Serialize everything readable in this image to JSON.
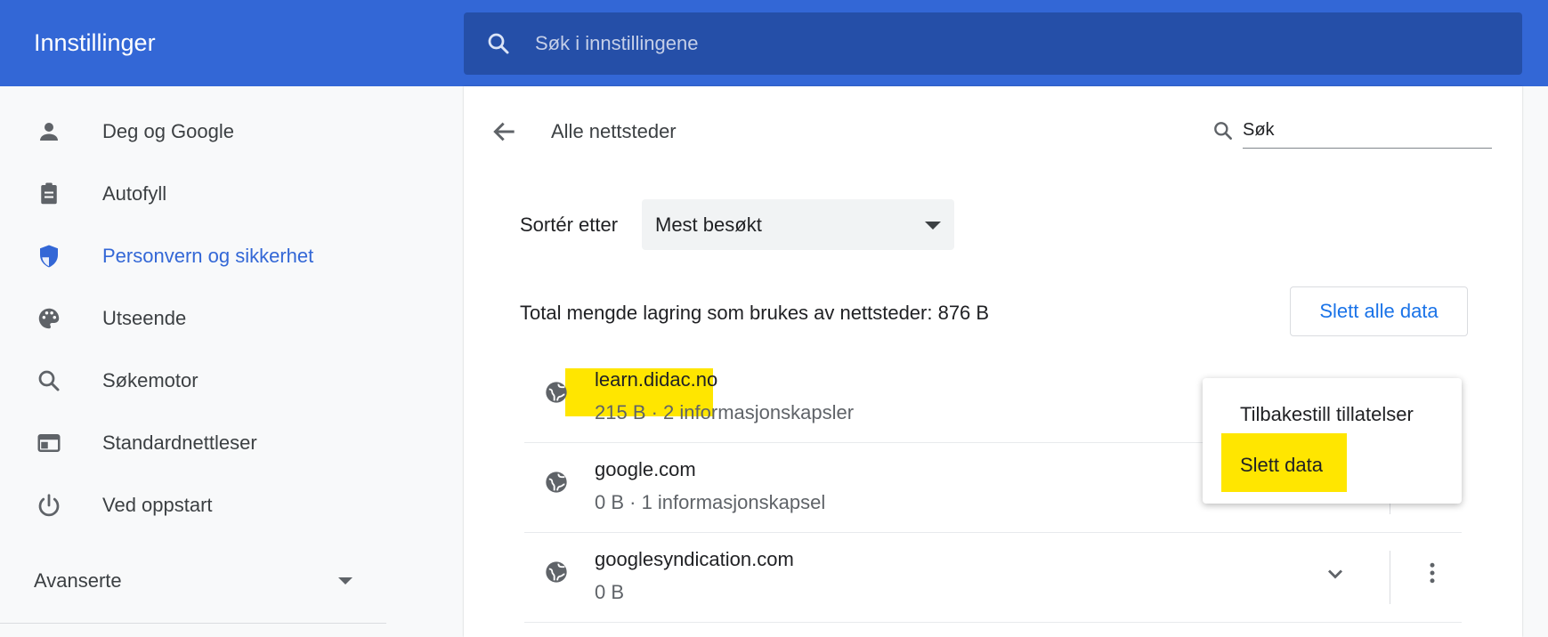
{
  "header": {
    "title": "Innstillinger",
    "search_placeholder": "Søk i innstillingene"
  },
  "sidebar": {
    "items": [
      {
        "label": "Deg og Google",
        "icon": "person-icon"
      },
      {
        "label": "Autofyll",
        "icon": "clipboard-icon"
      },
      {
        "label": "Personvern og sikkerhet",
        "icon": "shield-icon",
        "active": true
      },
      {
        "label": "Utseende",
        "icon": "palette-icon"
      },
      {
        "label": "Søkemotor",
        "icon": "search-icon"
      },
      {
        "label": "Standardnettleser",
        "icon": "browser-window-icon"
      },
      {
        "label": "Ved oppstart",
        "icon": "power-icon"
      }
    ],
    "advanced_label": "Avanserte"
  },
  "main": {
    "title": "Alle nettsteder",
    "filter_value": "Søk",
    "sort_label": "Sortér etter",
    "sort_value": "Mest besøkt",
    "total_label": "Total mengde lagring som brukes av nettsteder: 876 B",
    "clear_all_label": "Slett alle data",
    "sites": [
      {
        "name": "learn.didac.no",
        "meta": "215 B · 2 informasjonskapsler"
      },
      {
        "name": "google.com",
        "meta": "0 B · 1 informasjonskapsel"
      },
      {
        "name": "googlesyndication.com",
        "meta": "0 B"
      }
    ]
  },
  "menu": {
    "items": [
      "Tilbakestill tillatelser",
      "Slett data"
    ]
  },
  "colors": {
    "header": "#3367d6",
    "search_bar": "#254fa8",
    "accent": "#1a73e8",
    "highlight": "#ffe600"
  }
}
